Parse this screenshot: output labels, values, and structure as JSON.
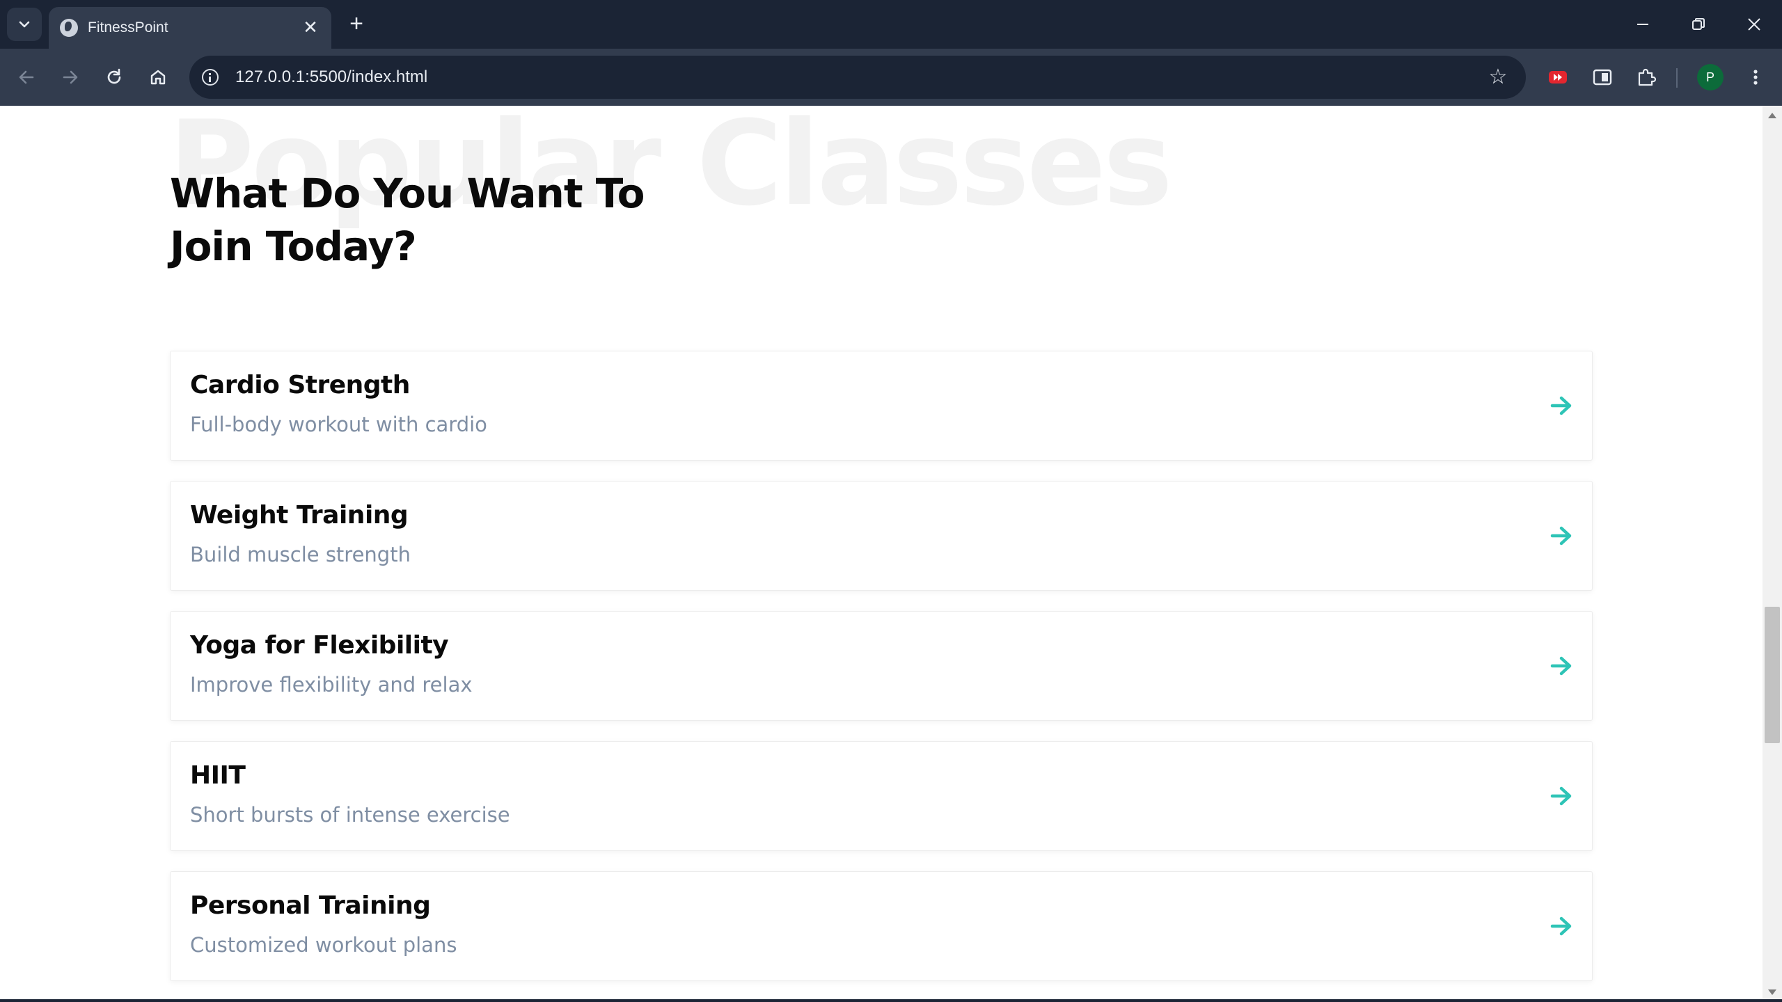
{
  "browser": {
    "tab_title": "FitnessPoint",
    "tab_close": "✕",
    "new_tab": "+",
    "url": "127.0.0.1:5500/index.html",
    "profile_initial": "P"
  },
  "page": {
    "watermark": "Popular Classes",
    "heading_line1": "What Do You Want To",
    "heading_line2": "Join Today?",
    "accent_color": "#2ec4b6",
    "classes": [
      {
        "title": "Cardio Strength",
        "description": "Full-body workout with cardio"
      },
      {
        "title": "Weight Training",
        "description": "Build muscle strength"
      },
      {
        "title": "Yoga for Flexibility",
        "description": "Improve flexibility and relax"
      },
      {
        "title": "HIIT",
        "description": "Short bursts of intense exercise"
      },
      {
        "title": "Personal Training",
        "description": "Customized workout plans"
      }
    ]
  }
}
